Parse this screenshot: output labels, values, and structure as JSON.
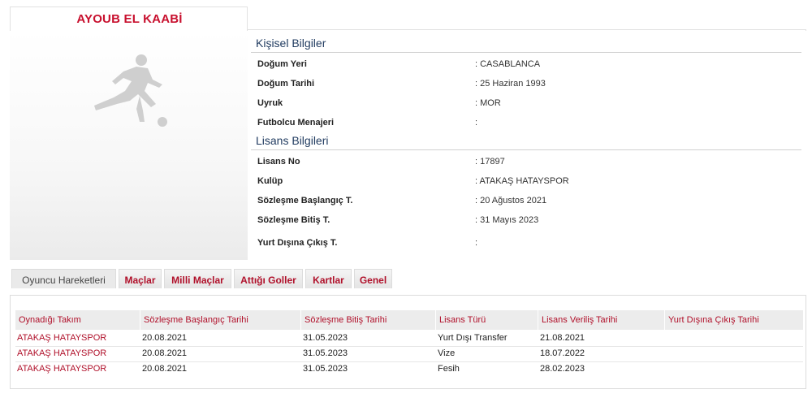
{
  "player": {
    "name": "AYOUB EL KAABİ"
  },
  "personal": {
    "title": "Kişisel Bilgiler",
    "rows": [
      {
        "label": "Doğum Yeri",
        "value": ":  CASABLANCA"
      },
      {
        "label": "Doğum Tarihi",
        "value": ":  25 Haziran 1993"
      },
      {
        "label": "Uyruk",
        "value": ":  MOR"
      },
      {
        "label": "Futbolcu Menajeri",
        "value": ":"
      }
    ]
  },
  "license": {
    "title": "Lisans Bilgileri",
    "rows": [
      {
        "label": "Lisans No",
        "value": ": 17897"
      },
      {
        "label": "Kulüp",
        "value": ": ATAKAŞ HATAYSPOR"
      },
      {
        "label": "Sözleşme Başlangıç T.",
        "value": ": 20 Ağustos 2021"
      },
      {
        "label": "Sözleşme Bitiş T.",
        "value": ": 31 Mayıs 2023"
      },
      {
        "label": "Yurt Dışına Çıkış T.",
        "value": ":"
      }
    ]
  },
  "tabs": [
    {
      "label": "Oyuncu Hareketleri",
      "active": true
    },
    {
      "label": "Maçlar"
    },
    {
      "label": "Milli Maçlar"
    },
    {
      "label": "Attığı Goller"
    },
    {
      "label": "Kartlar"
    },
    {
      "label": "Genel"
    }
  ],
  "table": {
    "headers": [
      "Oynadığı Takım",
      "Sözleşme Başlangıç Tarihi",
      "Sözleşme Bitiş Tarihi",
      "Lisans Türü",
      "Lisans Veriliş Tarihi",
      "Yurt Dışına Çıkış Tarihi"
    ],
    "rows": [
      [
        "ATAKAŞ HATAYSPOR",
        "20.08.2021",
        "31.05.2023",
        "Yurt Dışı Transfer",
        "21.08.2021",
        ""
      ],
      [
        "ATAKAŞ HATAYSPOR",
        "20.08.2021",
        "31.05.2023",
        "Vize",
        "18.07.2022",
        ""
      ],
      [
        "ATAKAŞ HATAYSPOR",
        "20.08.2021",
        "31.05.2023",
        "Fesih",
        "28.02.2023",
        ""
      ]
    ]
  },
  "colors": {
    "accent": "#c8102e",
    "section_title": "#1f3a5f"
  },
  "icons": {
    "photo_placeholder": "football-player-silhouette-icon"
  }
}
